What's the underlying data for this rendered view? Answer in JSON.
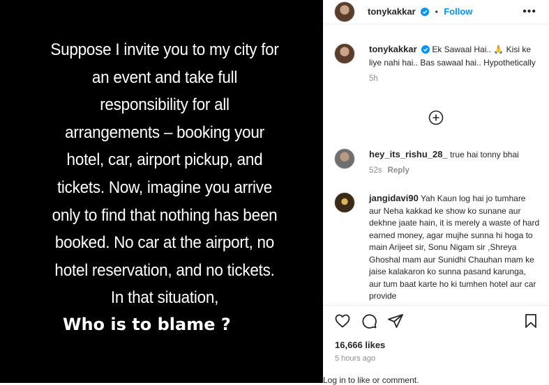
{
  "story": {
    "lines": [
      "Suppose I invite you to my city for",
      "an event and take full",
      "responsibility for all",
      "arrangements – booking your",
      "hotel, car, airport pickup, and",
      "tickets. Now, imagine you arrive",
      "only to find that nothing has been",
      "booked. No car at the airport, no",
      "hotel reservation, and no tickets.",
      "In that situation,"
    ],
    "question": "Who is to blame ?"
  },
  "header": {
    "username": "tonykakkar",
    "separator": "•",
    "follow_label": "Follow",
    "more_label": "•••"
  },
  "caption": {
    "username": "tonykakkar",
    "text": "Ek Sawaal Hai.. 🙏 Kisi ke liye nahi hai.. Bas sawaal hai.. Hypothetically",
    "time": "5h"
  },
  "comments": [
    {
      "username": "hey_its_rishu_28_",
      "text": "true hai tonny bhai",
      "time": "52s",
      "reply_label": "Reply"
    },
    {
      "username": "jangidavi90",
      "text": "Yah Kaun log hai jo tumhare aur Neha kakkad ke show ko sunane aur dekhne jaate hain, it is merely a waste of hard earned money, agar mujhe sunna hi hoga to main Arijeet sir, Sonu Nigam sir ,Shreya Ghoshal mam aur Sunidhi Chauhan mam ke jaise kalakaron ko sunna pasand karunga, aur tum baat karte ho ki tumhen hotel aur car provide"
    }
  ],
  "stats": {
    "likes": "16,666 likes",
    "posted": "5 hours ago"
  },
  "footer": {
    "login_link": "Log in",
    "login_rest": " to like or comment."
  },
  "colors": {
    "accent": "#0095f6",
    "muted": "#8e8e8e",
    "image_bg": "#000000"
  },
  "icons": [
    "heart-icon",
    "comment-icon",
    "share-icon",
    "bookmark-icon",
    "add-circle-icon",
    "verified-icon",
    "more-icon"
  ]
}
